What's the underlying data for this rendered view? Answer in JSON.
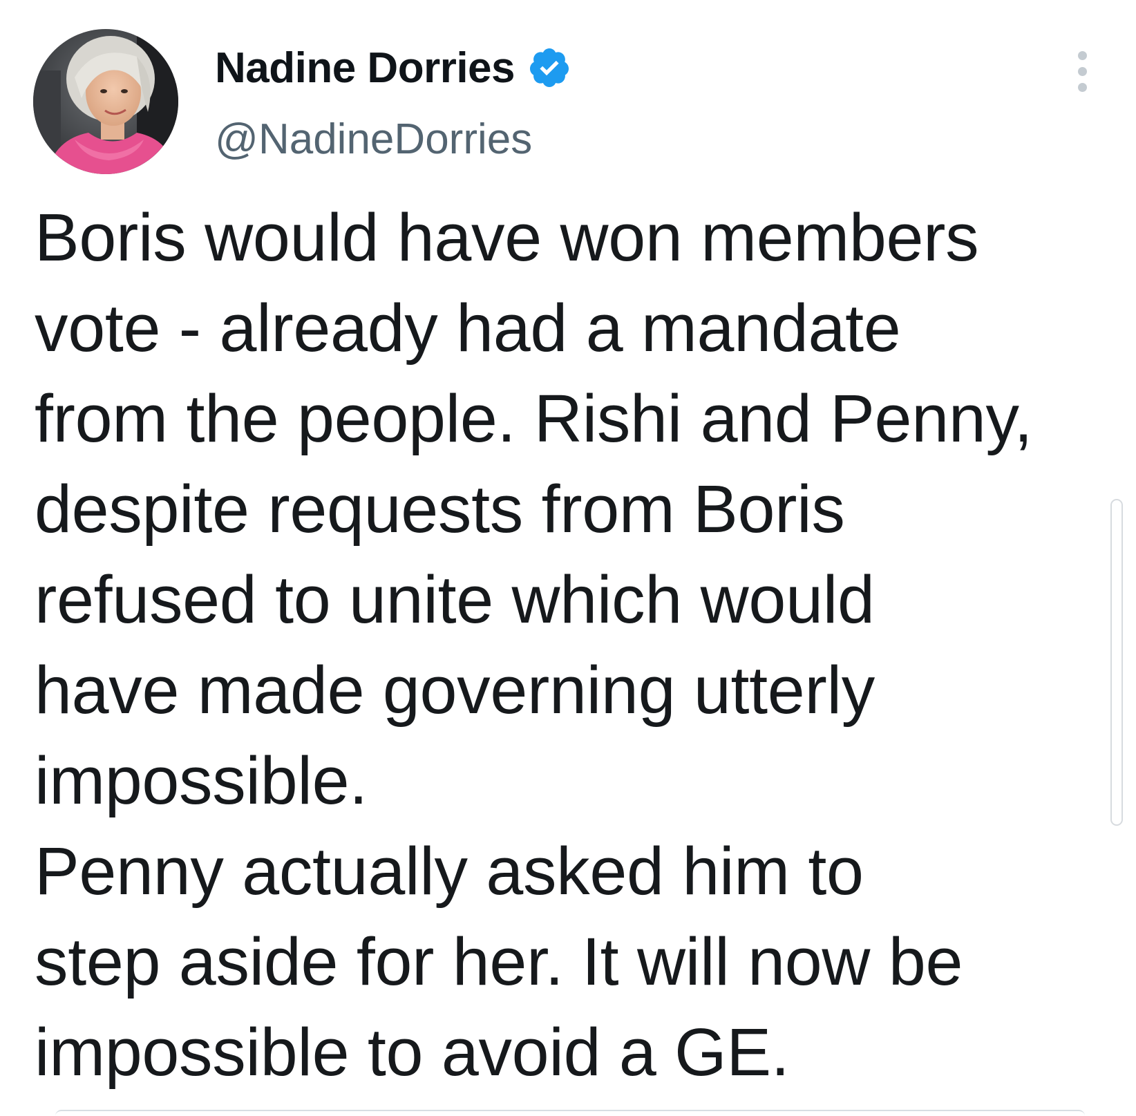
{
  "author": {
    "display_name": "Nadine Dorries",
    "handle": "@NadineDorries",
    "verified": true,
    "verified_icon": "verified-badge-icon",
    "verified_color": "#1d9bf0"
  },
  "menu": {
    "icon": "more-options-icon"
  },
  "tweet": {
    "lines": [
      "Boris would have won members",
      "vote  - already had a mandate",
      "from the people. Rishi and Penny,",
      "despite requests from Boris",
      "refused to unite which would",
      "have made governing utterly",
      "impossible.",
      "Penny actually asked him to",
      "step aside for her. It will now be",
      "impossible to avoid a GE."
    ]
  },
  "colors": {
    "text": "#0f1419",
    "secondary_text": "#536471",
    "background": "#ffffff"
  }
}
